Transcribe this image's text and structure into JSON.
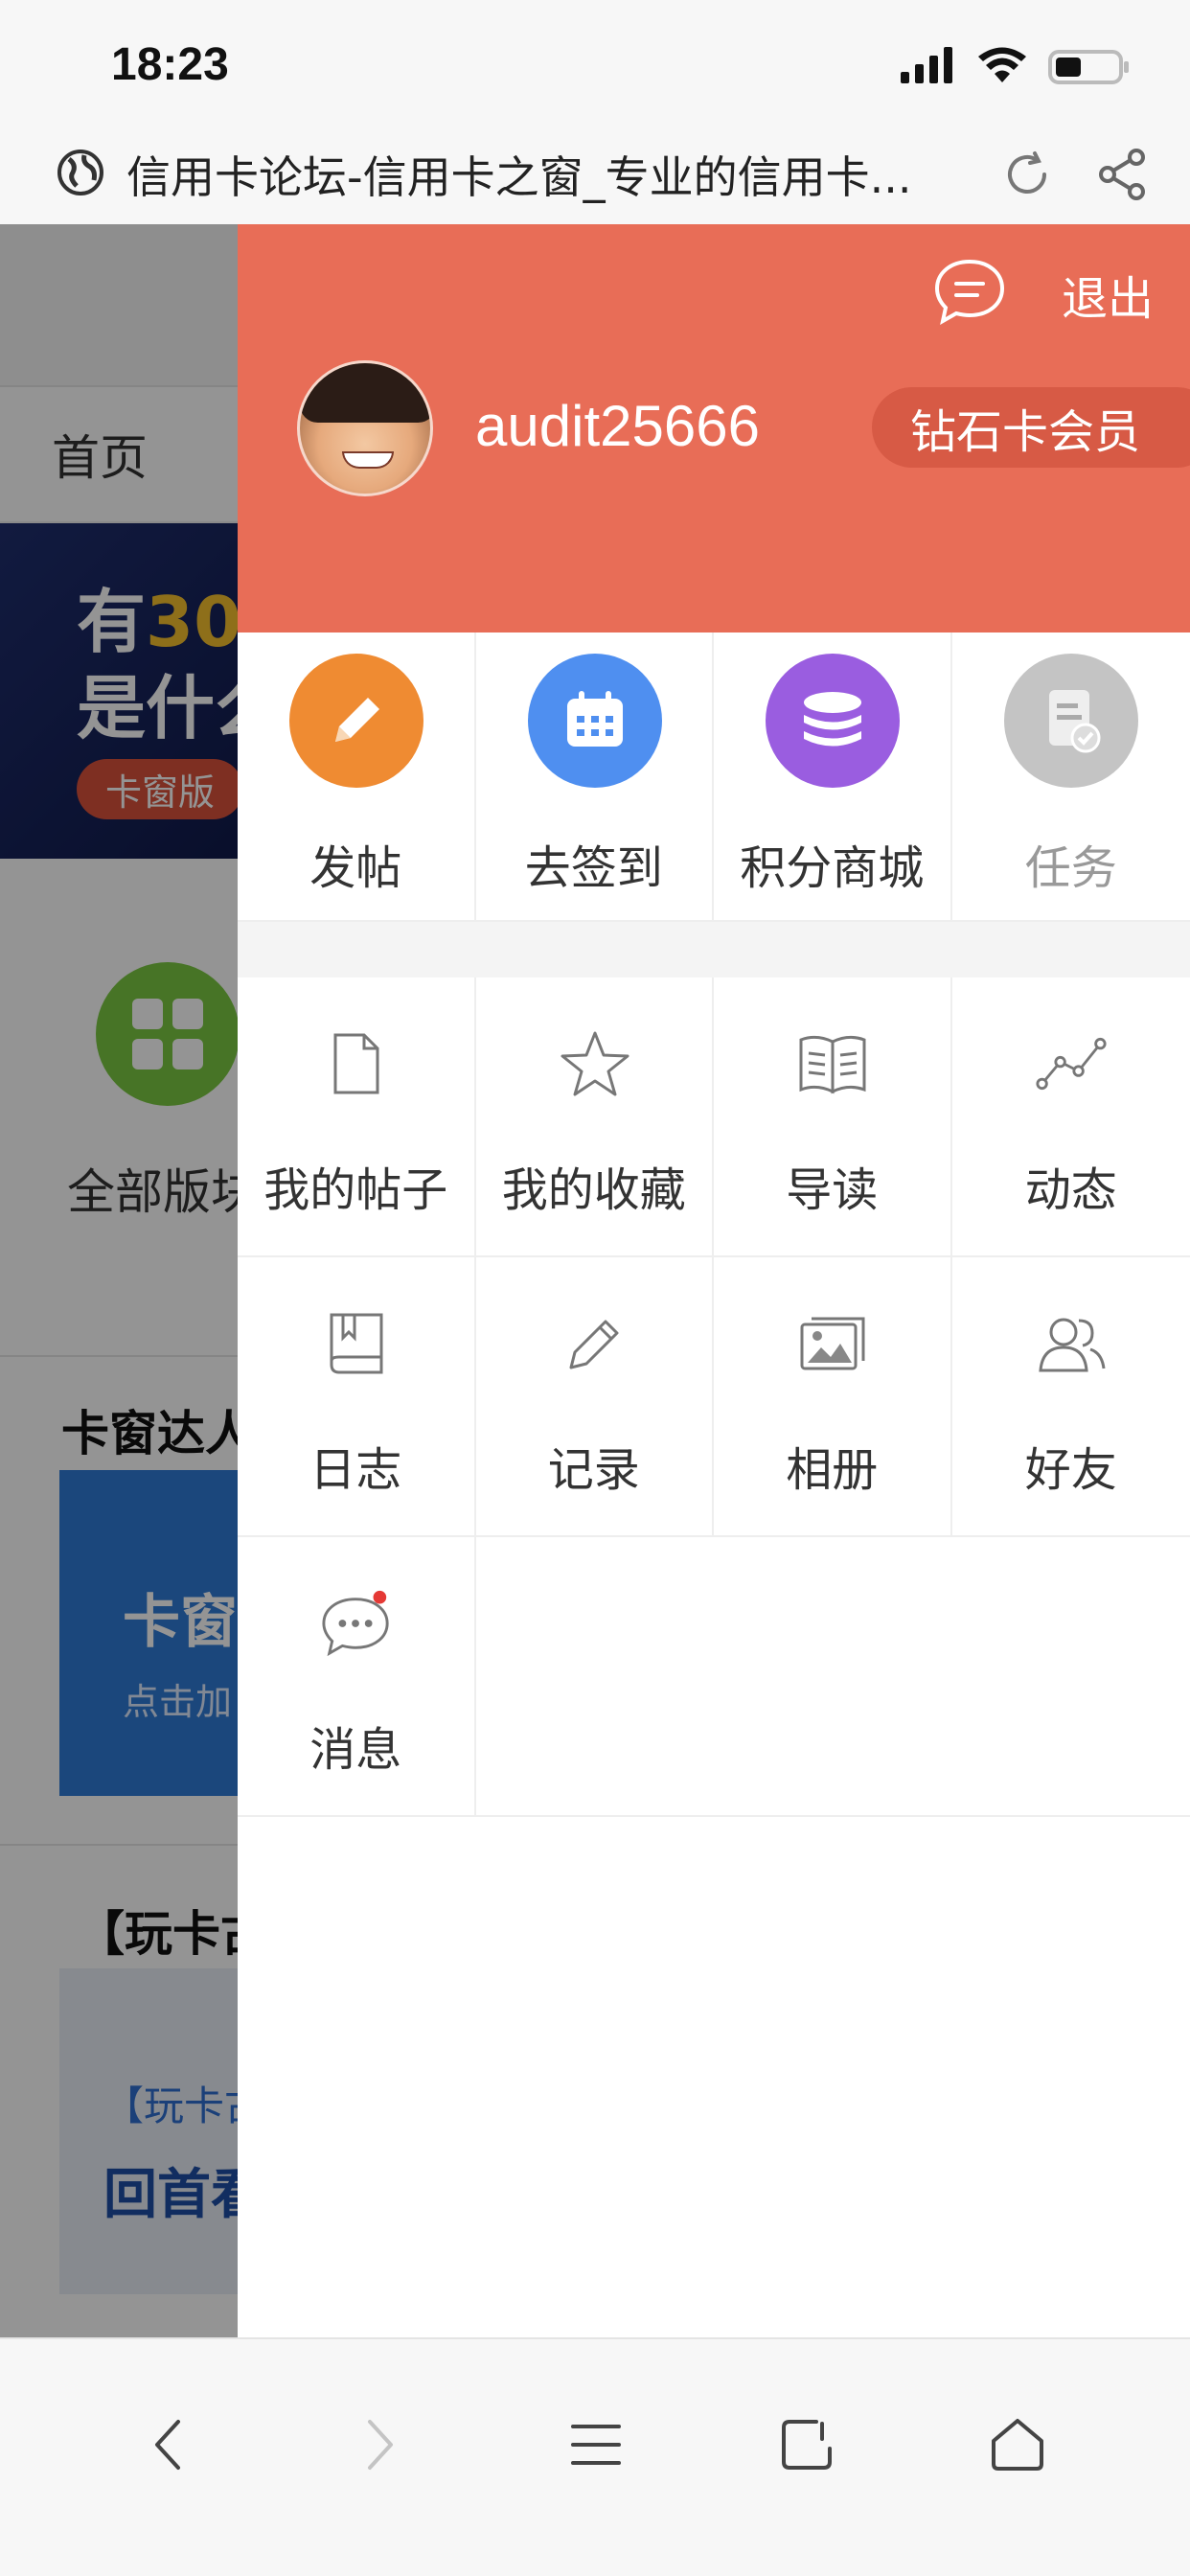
{
  "status_bar": {
    "time": "18:23"
  },
  "browser": {
    "title": "信用卡论坛-信用卡之窗_专业的信用卡..."
  },
  "background_page": {
    "nav_home": "首页",
    "banner_line1_a": "有",
    "banner_line1_b": "30",
    "banner_line2": "是什么",
    "banner_pill": "卡窗版",
    "all_boards_label": "全部版块",
    "section_title_1": "卡窗达人",
    "blue_card_title": "卡窗",
    "blue_card_sub": "点击加",
    "section_title_2": "【玩卡古",
    "grey_card_tag": "【玩卡古",
    "grey_card_title": "回首看"
  },
  "drawer": {
    "logout": "退出",
    "username": "audit25666",
    "member_level": "钻石卡会员",
    "quick_actions": [
      {
        "label": "发帖",
        "icon": "pencil-icon",
        "color": "#ef8b32"
      },
      {
        "label": "去签到",
        "icon": "calendar-icon",
        "color": "#4f8ff0"
      },
      {
        "label": "积分商城",
        "icon": "coins-icon",
        "color": "#9a5de0"
      },
      {
        "label": "任务",
        "icon": "task-icon",
        "color": "#c4c4c4"
      }
    ],
    "menu": [
      {
        "label": "我的帖子",
        "icon": "document-icon"
      },
      {
        "label": "我的收藏",
        "icon": "star-icon"
      },
      {
        "label": "导读",
        "icon": "open-book-icon"
      },
      {
        "label": "动态",
        "icon": "trend-icon"
      },
      {
        "label": "日志",
        "icon": "journal-icon"
      },
      {
        "label": "记录",
        "icon": "pen-icon"
      },
      {
        "label": "相册",
        "icon": "album-icon"
      },
      {
        "label": "好友",
        "icon": "friends-icon"
      },
      {
        "label": "消息",
        "icon": "message-icon"
      }
    ]
  }
}
